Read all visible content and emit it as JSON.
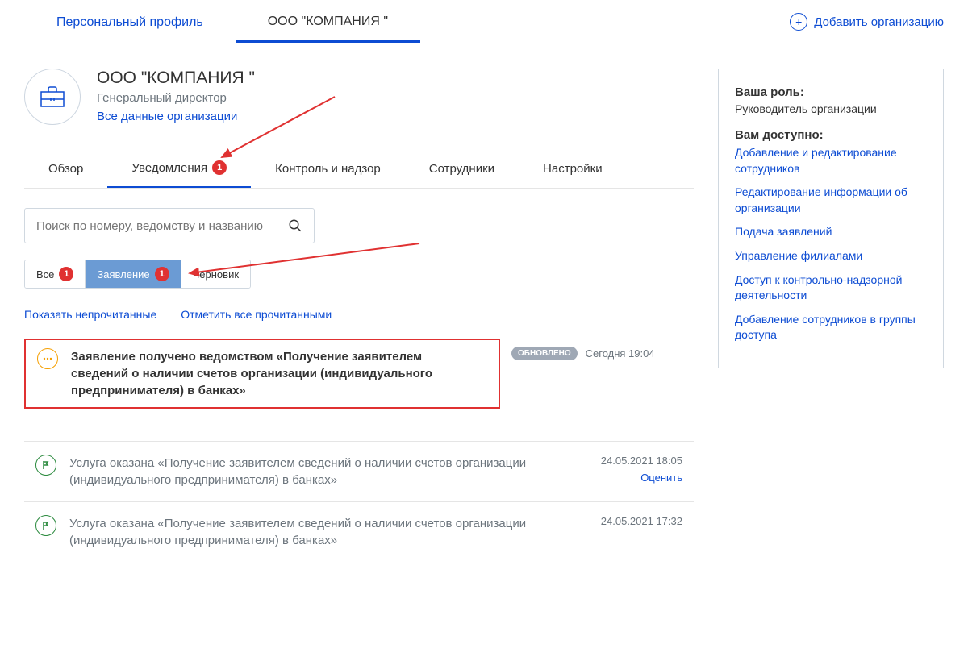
{
  "topTabs": {
    "personal": "Персональный профиль",
    "org": "ООО \"КОМПАНИЯ \""
  },
  "addOrg": "Добавить организацию",
  "orgHeader": {
    "title": "ООО \"КОМПАНИЯ \"",
    "position": "Генеральный директор",
    "allData": "Все данные организации"
  },
  "innerTabs": {
    "overview": "Обзор",
    "notifications": "Уведомления",
    "notifBadge": "1",
    "control": "Контроль и надзор",
    "employees": "Сотрудники",
    "settings": "Настройки"
  },
  "searchPlaceholder": "Поиск по номеру, ведомству и названию",
  "filters": {
    "all": "Все",
    "allBadge": "1",
    "application": "Заявление",
    "appBadge": "1",
    "draft": "Черновик"
  },
  "actions": {
    "showUnread": "Показать непрочитанные",
    "markRead": "Отметить все прочитанными"
  },
  "highlighted": {
    "text": "Заявление получено ведомством «Получение заявителем сведений о наличии счетов организации (индивидуального предпринимателя) в банках»",
    "status": "ОБНОВЛЕНО",
    "time": "Сегодня 19:04"
  },
  "rows": [
    {
      "text": "Услуга оказана «Получение заявителем сведений о наличии счетов организации (индивидуального предпринимателя) в банках»",
      "time": "24.05.2021 18:05",
      "rate": "Оценить"
    },
    {
      "text": "Услуга оказана «Получение заявителем сведений о наличии счетов организации (индивидуального предпринимателя) в банках»",
      "time": "24.05.2021 17:32"
    }
  ],
  "sidebar": {
    "roleLabel": "Ваша роль:",
    "roleValue": "Руководитель организации",
    "availLabel": "Вам доступно:",
    "perms": [
      "Добавление и редактирование сотрудников",
      "Редактирование информации об организации",
      "Подача заявлений",
      "Управление филиалами",
      "Доступ к контрольно-надзорной деятельности",
      "Добавление сотрудников в группы доступа"
    ]
  }
}
